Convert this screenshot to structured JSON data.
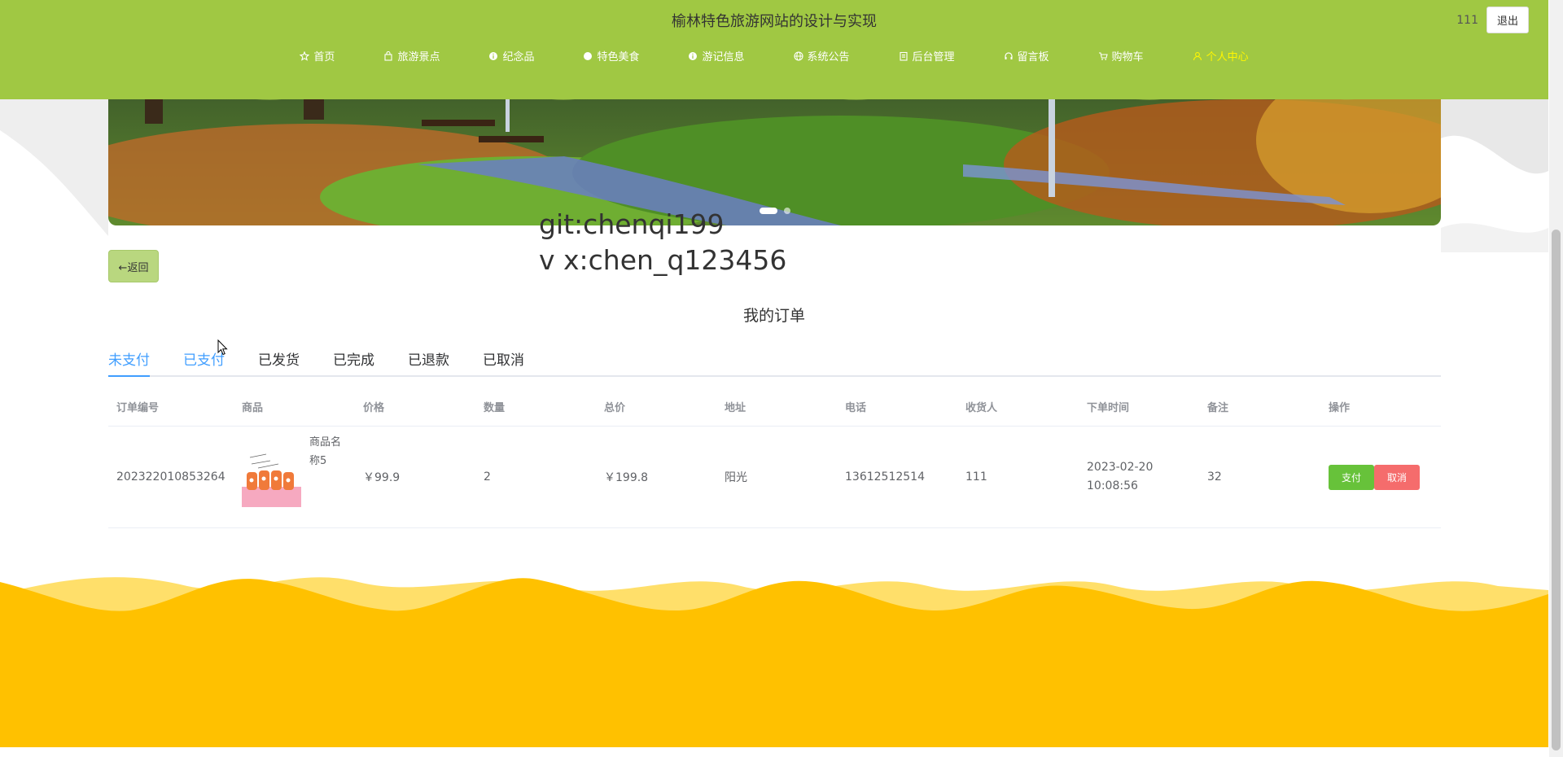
{
  "header": {
    "site_title": "榆林特色旅游网站的设计与实现",
    "username": "111",
    "logout_label": "退出",
    "nav": [
      {
        "label": "首页",
        "icon": "star-icon"
      },
      {
        "label": "旅游景点",
        "icon": "bag-icon"
      },
      {
        "label": "纪念品",
        "icon": "info-icon"
      },
      {
        "label": "特色美食",
        "icon": "circle-icon"
      },
      {
        "label": "游记信息",
        "icon": "info-icon"
      },
      {
        "label": "系统公告",
        "icon": "globe-icon"
      },
      {
        "label": "后台管理",
        "icon": "building-icon"
      },
      {
        "label": "留言板",
        "icon": "headset-icon"
      },
      {
        "label": "购物车",
        "icon": "cart-icon"
      },
      {
        "label": "个人中心",
        "icon": "user-icon"
      }
    ],
    "active_nav": "个人中心"
  },
  "watermark": {
    "line1": "git:chenqi199",
    "line2": "v x:chen_q123456"
  },
  "back_label": "←返回",
  "page_title": "我的订单",
  "tabs": [
    "未支付",
    "已支付",
    "已发货",
    "已完成",
    "已退款",
    "已取消"
  ],
  "active_tab": "未支付",
  "table": {
    "headers": [
      "订单编号",
      "商品",
      "价格",
      "数量",
      "总价",
      "地址",
      "电话",
      "收货人",
      "下单时间",
      "备注",
      "操作"
    ],
    "rows": [
      {
        "order_id": "202322010853264",
        "goods_name": "商品名称5",
        "price": "￥99.9",
        "quantity": "2",
        "total": "￥199.8",
        "address": "阳光",
        "phone": "13612512514",
        "receiver": "111",
        "order_time": "2023-02-20 10:08:56",
        "note": "32",
        "pay_label": "支付",
        "cancel_label": "取消"
      }
    ]
  },
  "colors": {
    "header_green": "#a0c843",
    "active_nav": "#fff600",
    "tab_active": "#409eff",
    "pay_button": "#67c23a",
    "cancel_button": "#f56c6c",
    "footer_yellow": "#ffc100"
  }
}
